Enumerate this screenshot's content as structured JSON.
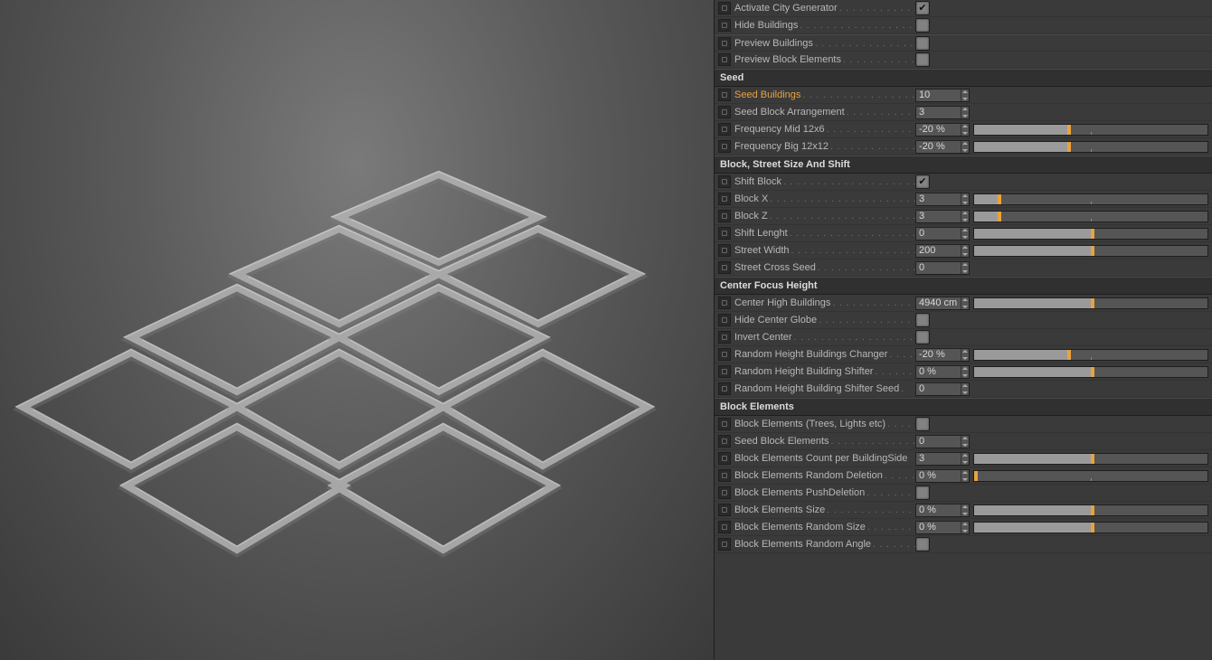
{
  "general": {
    "activate_city_generator": {
      "label": "Activate City Generator",
      "checked": true
    },
    "hide_buildings": {
      "label": "Hide Buildings",
      "checked": false
    },
    "preview_buildings": {
      "label": "Preview Buildings",
      "checked": false
    },
    "preview_block_elements": {
      "label": "Preview Block Elements",
      "checked": false
    }
  },
  "seed": {
    "header": "Seed",
    "seed_buildings": {
      "label": "Seed Buildings",
      "value": "10",
      "highlight": true
    },
    "seed_block_arrangement": {
      "label": "Seed Block Arrangement",
      "value": "3"
    },
    "frequency_mid_12x6": {
      "label": "Frequency Mid 12x6",
      "value": "-20 %",
      "slider": 40
    },
    "frequency_big_12x12": {
      "label": "Frequency Big 12x12",
      "value": "-20 %",
      "slider": 40
    }
  },
  "block_street": {
    "header": "Block, Street Size And Shift",
    "shift_block": {
      "label": "Shift Block",
      "checked": true
    },
    "block_x": {
      "label": "Block X",
      "value": "3",
      "slider": 10
    },
    "block_z": {
      "label": "Block Z",
      "value": "3",
      "slider": 10
    },
    "shift_lenght": {
      "label": "Shift Lenght",
      "value": "0",
      "slider": 50
    },
    "street_width": {
      "label": "Street Width",
      "value": "200",
      "slider": 50
    },
    "street_cross_seed": {
      "label": "Street Cross Seed",
      "value": "0"
    }
  },
  "center_focus": {
    "header": "Center Focus Height",
    "center_high_buildings": {
      "label": "Center High Buildings",
      "value": "4940 cm",
      "slider": 50
    },
    "hide_center_globe": {
      "label": "Hide Center Globe",
      "checked": false
    },
    "invert_center": {
      "label": "Invert Center",
      "checked": false
    },
    "random_height_buildings_changer": {
      "label": "Random Height Buildings Changer",
      "value": "-20 %",
      "slider": 40
    },
    "random_height_building_shifter": {
      "label": "Random Height Building Shifter",
      "value": "0 %",
      "slider": 50
    },
    "random_height_building_shifter_seed": {
      "label": "Random Height Building Shifter Seed",
      "value": "0"
    }
  },
  "block_elements": {
    "header": "Block Elements",
    "block_elements_trees_lights": {
      "label": "Block Elements (Trees, Lights etc)",
      "checked": false
    },
    "seed_block_elements": {
      "label": "Seed Block Elements",
      "value": "0"
    },
    "block_elements_count_per_side": {
      "label": "Block Elements Count per BuildingSide",
      "value": "3",
      "slider": 50
    },
    "block_elements_random_deletion": {
      "label": "Block Elements Random Deletion",
      "value": "0 %",
      "slider": 0
    },
    "block_elements_push_deletion": {
      "label": "Block Elements PushDeletion",
      "checked": false
    },
    "block_elements_size": {
      "label": "Block Elements Size",
      "value": "0 %",
      "slider": 50
    },
    "block_elements_random_size": {
      "label": "Block Elements Random Size",
      "value": "0 %",
      "slider": 50
    },
    "block_elements_random_angle": {
      "label": "Block Elements Random Angle",
      "checked": false
    }
  }
}
